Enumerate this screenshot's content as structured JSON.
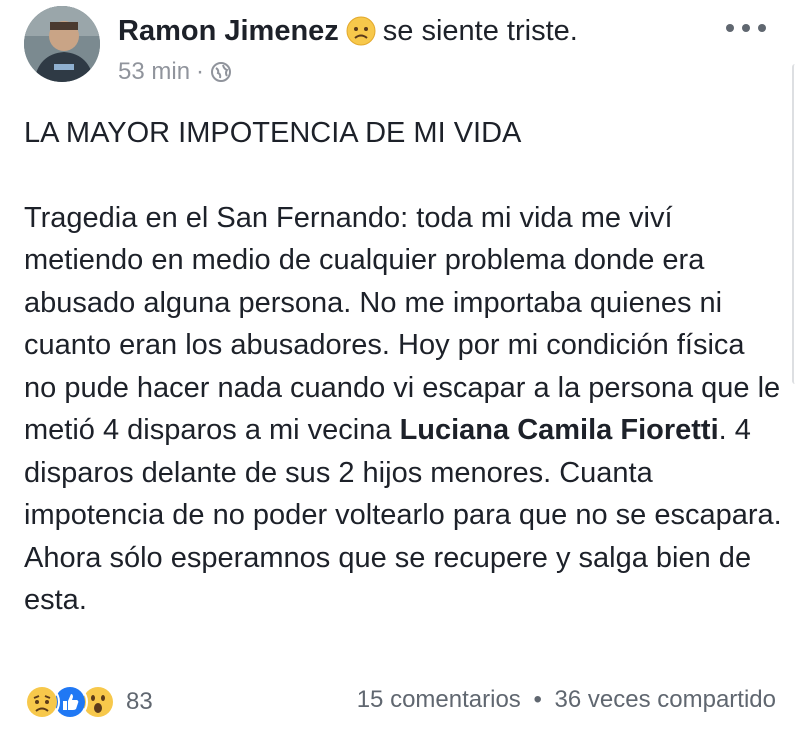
{
  "post": {
    "author": "Ramon Jimenez",
    "feeling": "se siente triste.",
    "time": "53 min",
    "meta_separator": "·",
    "title": "LA MAYOR IMPOTENCIA DE MI VIDA",
    "body_before_bold": "Tragedia en el San Fernando: toda mi vida me viví metiendo en medio de cualquier problema donde era abusado alguna persona. No me importaba quienes ni cuanto eran los abusadores. Hoy por mi condición física no pude hacer nada cuando vi escapar a la persona que le metió 4 disparos a mi vecina ",
    "body_bold": "Luciana Camila Fioretti",
    "body_after_bold": ". 4 disparos delante de sus 2 hijos menores. Cuanta impotencia de no poder voltearlo para que no se escapara. Ahora sólo esperamnos que se recupere y salga bien de esta."
  },
  "footer": {
    "reaction_count": "83",
    "comments": "15 comentarios",
    "separator": "•",
    "shares": "36 veces compartido"
  },
  "icons": {
    "feeling": "sad-face-icon",
    "privacy": "globe-icon",
    "more": "more-options-icon",
    "reactions": [
      "sad-reaction-icon",
      "like-reaction-icon",
      "wow-reaction-icon"
    ]
  },
  "colors": {
    "text": "#1d2129",
    "meta": "#90949c",
    "like_blue": "#2078f4",
    "emoji_yellow": "#f7c84b"
  }
}
